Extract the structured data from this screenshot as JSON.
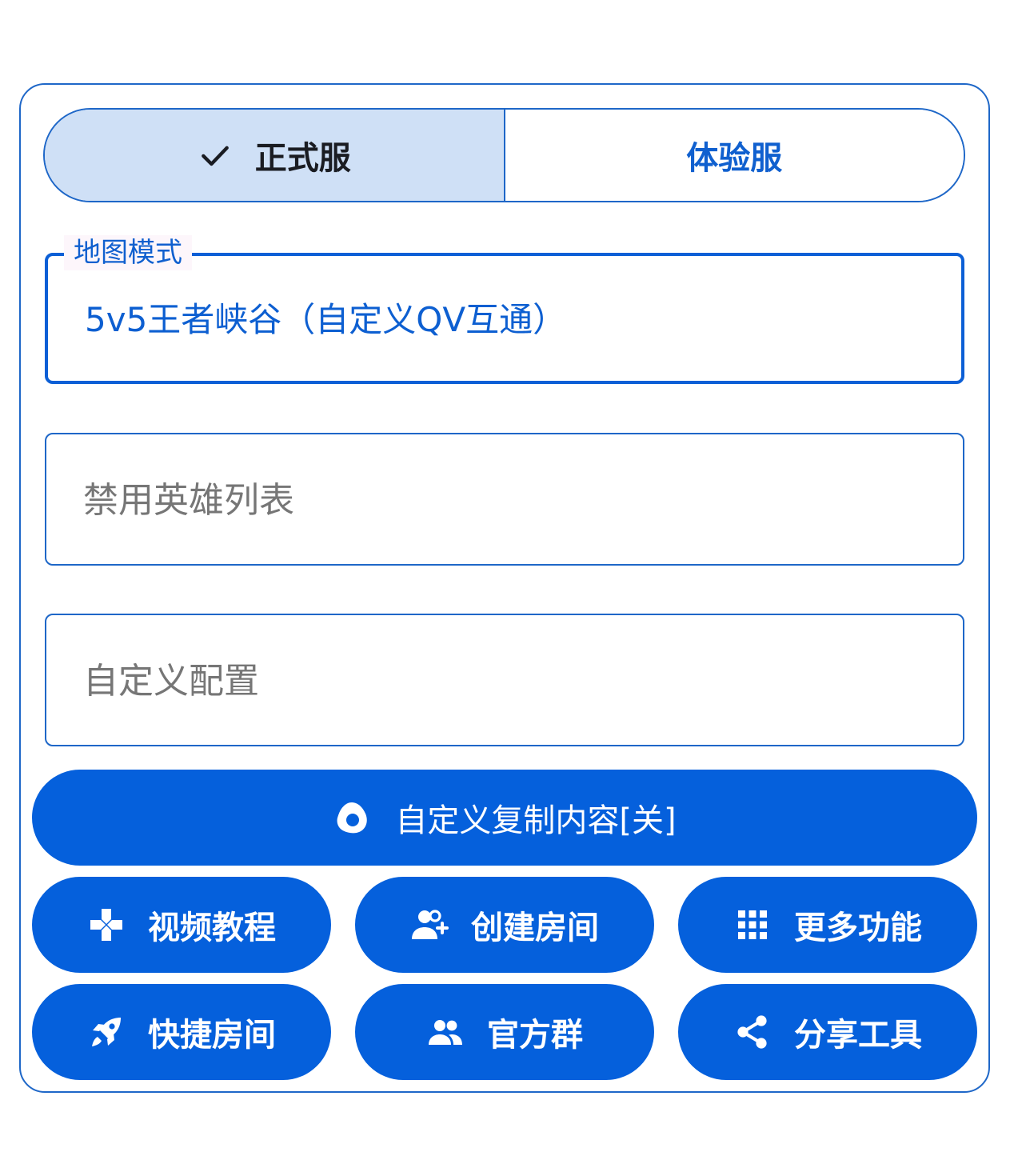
{
  "server_toggle": {
    "options": [
      {
        "label": "正式服",
        "selected": true
      },
      {
        "label": "体验服",
        "selected": false
      }
    ]
  },
  "map_mode": {
    "label": "地图模式",
    "value": "5v5王者峡谷（自定义QV互通）"
  },
  "banned_heroes": {
    "placeholder": "禁用英雄列表"
  },
  "custom_config": {
    "placeholder": "自定义配置"
  },
  "copy_button": {
    "label": "自定义复制内容[关]",
    "icon": "egg-icon"
  },
  "actions": [
    {
      "label": "视频教程",
      "icon": "gamepad-icon"
    },
    {
      "label": "创建房间",
      "icon": "person-add-icon"
    },
    {
      "label": "更多功能",
      "icon": "apps-grid-icon"
    },
    {
      "label": "快捷房间",
      "icon": "rocket-icon"
    },
    {
      "label": "官方群",
      "icon": "group-icon"
    },
    {
      "label": "分享工具",
      "icon": "share-icon"
    }
  ],
  "colors": {
    "primary": "#0560dc",
    "outline": "#1e67c8",
    "selected_segment": "#cfe0f6"
  }
}
